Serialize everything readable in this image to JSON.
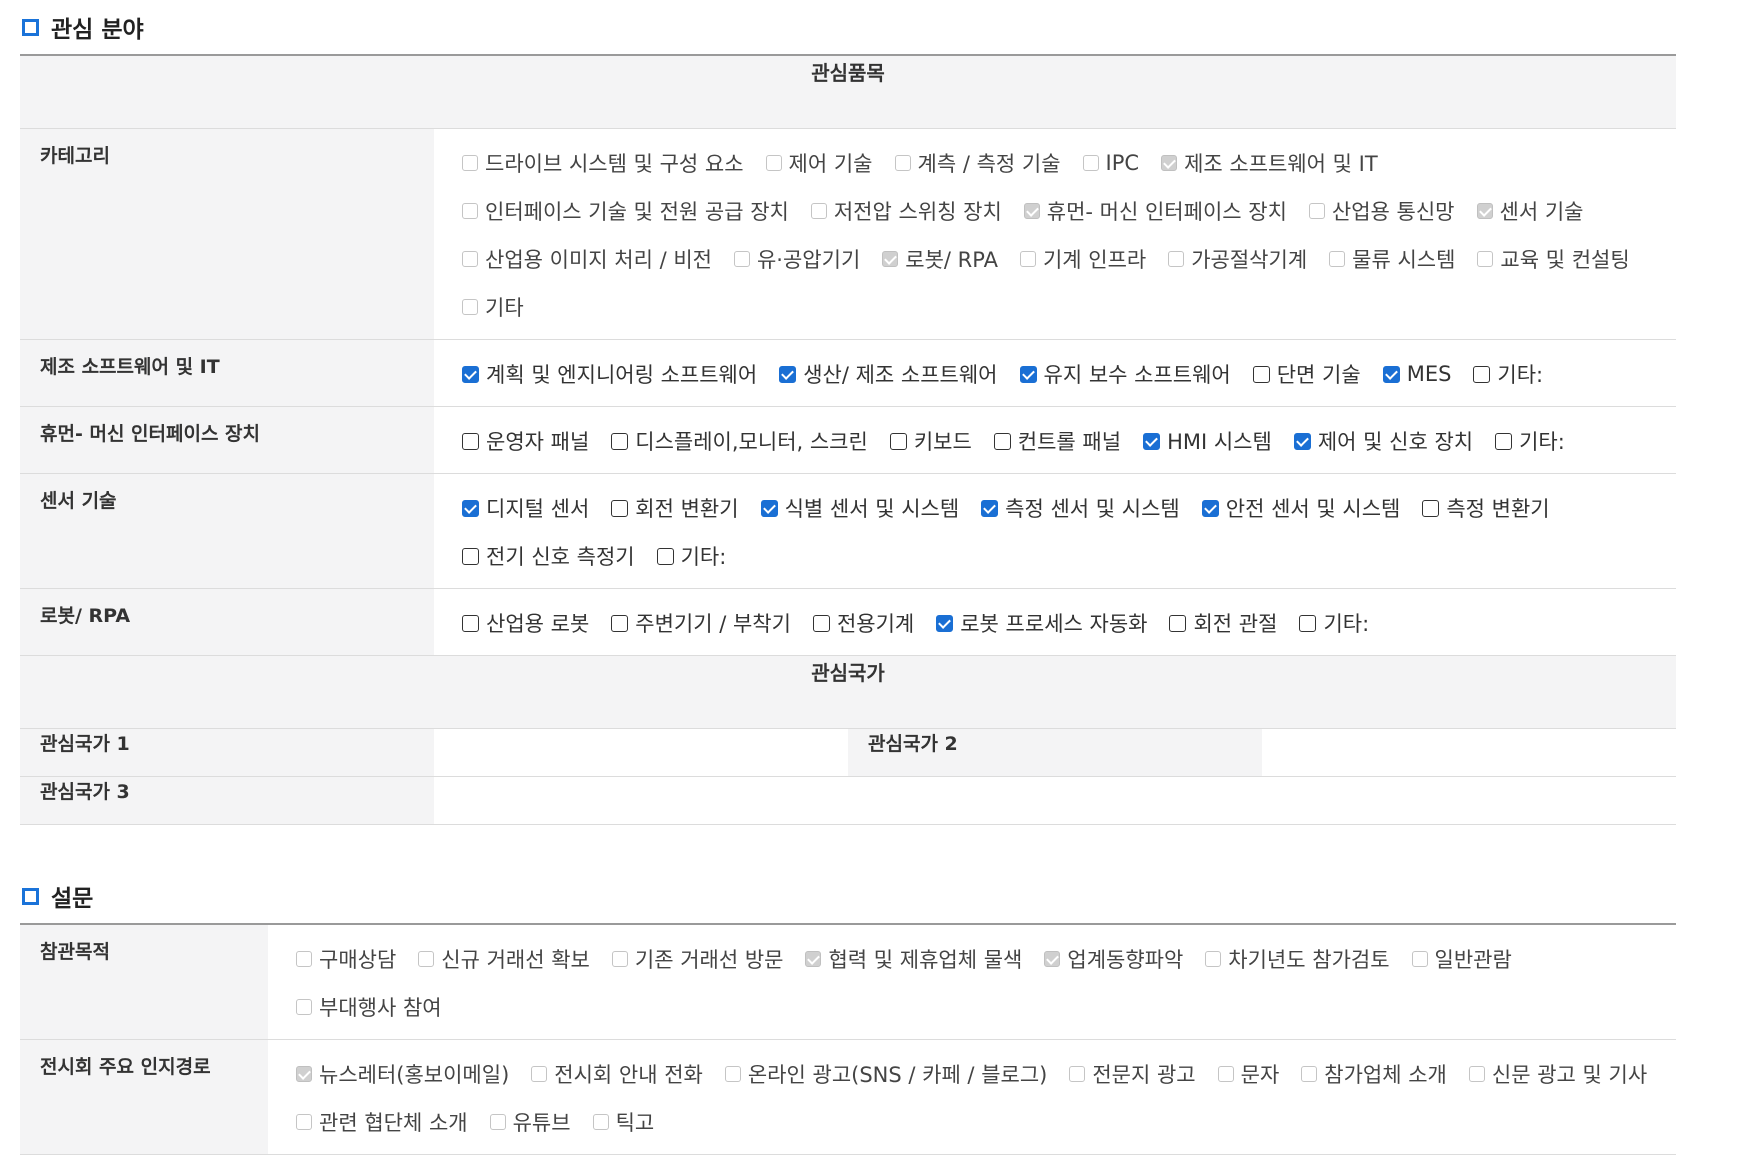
{
  "interest": {
    "section_title": "관심 분야",
    "items_header": "관심품목",
    "rows": [
      {
        "label": "카테고리",
        "style": "dim",
        "options": [
          {
            "text": "드라이브 시스템 및 구성 요소",
            "checked": false
          },
          {
            "text": "제어 기술",
            "checked": false
          },
          {
            "text": "계측 / 측정 기술",
            "checked": false
          },
          {
            "text": "IPC",
            "checked": false
          },
          {
            "text": "제조 소프트웨어 및 IT",
            "checked": true
          },
          {
            "text": "인터페이스 기술 및 전원 공급 장치",
            "checked": false
          },
          {
            "text": "저전압 스위칭 장치",
            "checked": false
          },
          {
            "text": "휴먼- 머신 인터페이스 장치",
            "checked": true
          },
          {
            "text": "산업용 통신망",
            "checked": false
          },
          {
            "text": "센서 기술",
            "checked": true
          },
          {
            "text": "산업용 이미지 처리 / 비전",
            "checked": false
          },
          {
            "text": "유·공압기기",
            "checked": false
          },
          {
            "text": "로봇/ RPA",
            "checked": true
          },
          {
            "text": "기계 인프라",
            "checked": false
          },
          {
            "text": "가공절삭기계",
            "checked": false
          },
          {
            "text": "물류 시스템",
            "checked": false
          },
          {
            "text": "교육 및 컨설팅",
            "checked": false
          },
          {
            "text": "기타",
            "checked": false
          }
        ]
      },
      {
        "label": "제조 소프트웨어 및 IT",
        "style": "act",
        "options": [
          {
            "text": "계획 및 엔지니어링 소프트웨어",
            "checked": true
          },
          {
            "text": "생산/ 제조 소프트웨어",
            "checked": true
          },
          {
            "text": "유지 보수 소프트웨어",
            "checked": true
          },
          {
            "text": "단면 기술",
            "checked": false
          },
          {
            "text": "MES",
            "checked": true
          },
          {
            "text": "기타:",
            "checked": false
          }
        ]
      },
      {
        "label": "휴먼- 머신 인터페이스 장치",
        "style": "act",
        "options": [
          {
            "text": "운영자 패널",
            "checked": false
          },
          {
            "text": "디스플레이,모니터, 스크린",
            "checked": false
          },
          {
            "text": "키보드",
            "checked": false
          },
          {
            "text": "컨트롤 패널",
            "checked": false
          },
          {
            "text": "HMI 시스템",
            "checked": true
          },
          {
            "text": "제어 및 신호 장치",
            "checked": true
          },
          {
            "text": "기타:",
            "checked": false
          }
        ]
      },
      {
        "label": "센서 기술",
        "style": "act",
        "options": [
          {
            "text": "디지털 센서",
            "checked": true
          },
          {
            "text": "회전 변환기",
            "checked": false
          },
          {
            "text": "식별 센서 및 시스템",
            "checked": true
          },
          {
            "text": "측정 센서 및 시스템",
            "checked": true
          },
          {
            "text": "안전 센서 및 시스템",
            "checked": true
          },
          {
            "text": "측정 변환기",
            "checked": false
          },
          {
            "text": "전기 신호 측정기",
            "checked": false
          },
          {
            "text": "기타:",
            "checked": false
          }
        ]
      },
      {
        "label": "로봇/ RPA",
        "style": "act",
        "options": [
          {
            "text": "산업용 로봇",
            "checked": false
          },
          {
            "text": "주변기기 / 부착기",
            "checked": false
          },
          {
            "text": "전용기계",
            "checked": false
          },
          {
            "text": "로봇 프로세스 자동화",
            "checked": true
          },
          {
            "text": "회전 관절",
            "checked": false
          },
          {
            "text": "기타:",
            "checked": false
          }
        ]
      }
    ],
    "countries_header": "관심국가",
    "country1_label": "관심국가 1",
    "country2_label": "관심국가 2",
    "country3_label": "관심국가 3"
  },
  "survey": {
    "section_title": "설문",
    "rows": [
      {
        "label": "참관목적",
        "style": "dim",
        "options": [
          {
            "text": "구매상담",
            "checked": false
          },
          {
            "text": "신규 거래선 확보",
            "checked": false
          },
          {
            "text": "기존 거래선 방문",
            "checked": false
          },
          {
            "text": "협력 및 제휴업체 물색",
            "checked": true
          },
          {
            "text": "업계동향파악",
            "checked": true
          },
          {
            "text": "차기년도 참가검토",
            "checked": false
          },
          {
            "text": "일반관람",
            "checked": false
          },
          {
            "text": "부대행사 참여",
            "checked": false
          }
        ]
      },
      {
        "label": "전시회 주요 인지경로",
        "style": "dim",
        "options": [
          {
            "text": "뉴스레터(홍보이메일)",
            "checked": true
          },
          {
            "text": "전시회 안내 전화",
            "checked": false
          },
          {
            "text": "온라인 광고(SNS / 카페 / 블로그)",
            "checked": false
          },
          {
            "text": "전문지 광고",
            "checked": false
          },
          {
            "text": "문자",
            "checked": false
          },
          {
            "text": "참가업체 소개",
            "checked": false
          },
          {
            "text": "신문 광고 및 기사",
            "checked": false
          },
          {
            "text": "관련 협단체 소개",
            "checked": false
          },
          {
            "text": "유튜브",
            "checked": false
          },
          {
            "text": "틱고",
            "checked": false
          }
        ]
      }
    ]
  }
}
